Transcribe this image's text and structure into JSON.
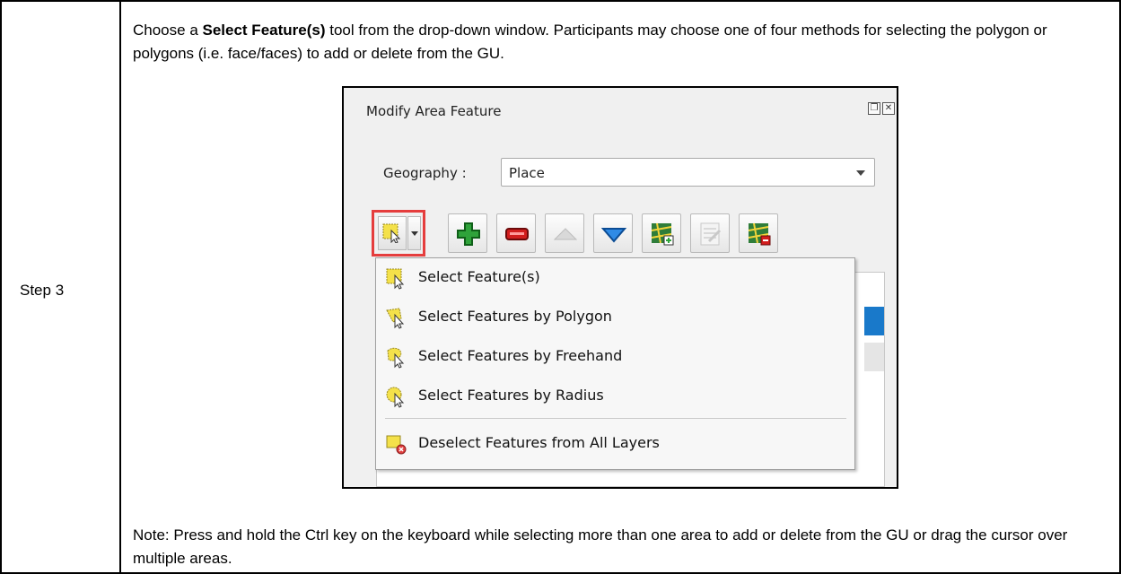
{
  "step": {
    "label": "Step 3"
  },
  "instruction": {
    "prefix": "Choose a ",
    "bold": "Select Feature(s)",
    "suffix": " tool from the drop-down window. Participants may choose one of four methods for selecting the polygon or polygons (i.e. face/faces) to add or delete from the GU."
  },
  "screenshot": {
    "panel_title": "Modify Area Feature",
    "window_buttons": [
      "restore-icon",
      "close-icon"
    ],
    "geography_label": "Geography :",
    "geography_value": "Place",
    "toolbar_icons": [
      "select-features-icon",
      "dropdown-arrow-icon",
      "add-icon",
      "remove-icon",
      "up-arrow-icon",
      "down-arrow-icon",
      "map-add-icon",
      "edit-table-icon",
      "map-remove-icon"
    ],
    "menu_items": [
      {
        "label": "Select Feature(s)",
        "icon": "select-feature-icon"
      },
      {
        "label": "Select Features by Polygon",
        "icon": "select-polygon-icon"
      },
      {
        "label": "Select Features by Freehand",
        "icon": "select-freehand-icon"
      },
      {
        "label": "Select Features by Radius",
        "icon": "select-radius-icon"
      },
      {
        "label": "Deselect Features from All Layers",
        "icon": "deselect-icon"
      }
    ],
    "highlight_color": "#e53d3d"
  },
  "note": {
    "text": "Note: Press and hold the Ctrl key on the keyboard while selecting more than one area to add or delete from the GU or drag the cursor over multiple areas."
  }
}
